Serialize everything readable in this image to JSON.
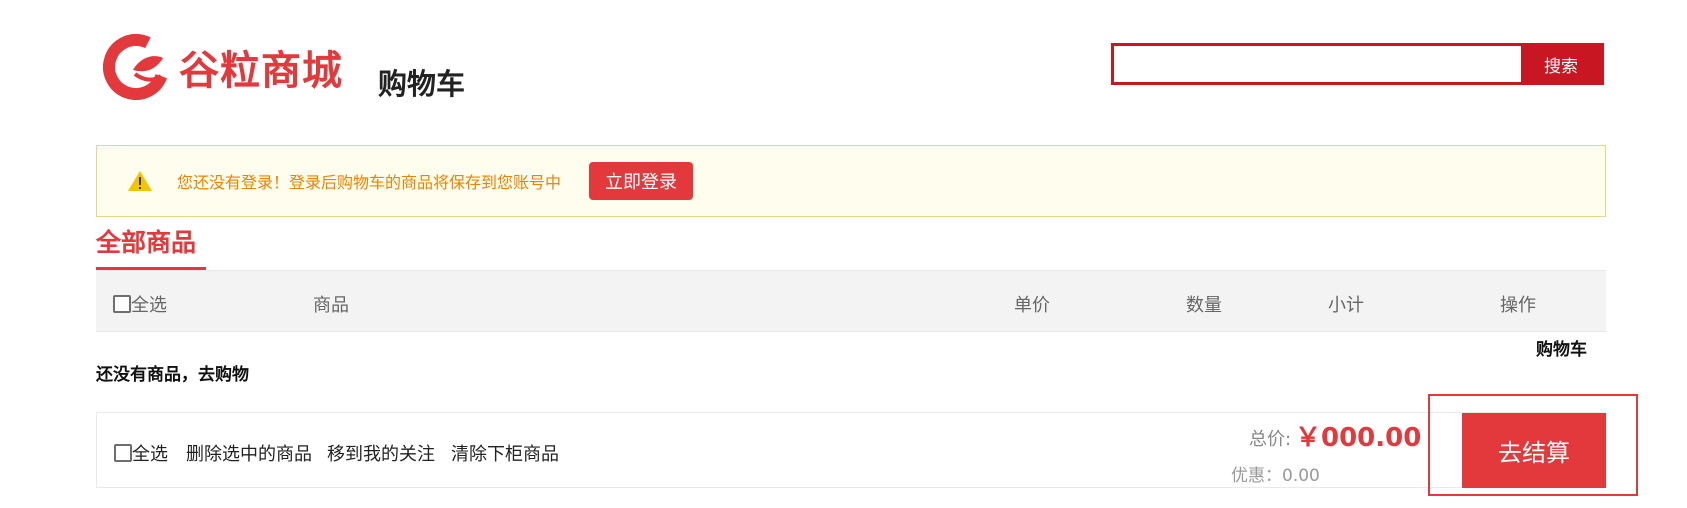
{
  "header": {
    "logo_text": "谷粒商城",
    "page_title": "购物车",
    "search": {
      "value": "",
      "placeholder": "",
      "button_label": "搜索"
    }
  },
  "notice": {
    "icon": "warning-icon",
    "text": "您还没有登录！登录后购物车的商品将保存到您账号中",
    "login_button": "立即登录"
  },
  "tabs": {
    "all_goods": "全部商品"
  },
  "table": {
    "columns": [
      "全选",
      "商品",
      "单价",
      "数量",
      "小计",
      "操作"
    ]
  },
  "cart_link": "购物车",
  "empty_message": "还没有商品，去购物",
  "bottom_bar": {
    "select_all": "全选",
    "delete_selected": "删除选中的商品",
    "move_to_follow": "移到我的关注",
    "clear_offshelf": "清除下柜商品",
    "total_label": "总价:",
    "total_value": "￥000.00",
    "discount": "优惠：0.00",
    "checkout_button": "去结算"
  },
  "colors": {
    "brand_red": "#e4393c",
    "search_red": "#c81623",
    "notice_orange": "#f08200",
    "notice_bg": "#fffdee"
  }
}
